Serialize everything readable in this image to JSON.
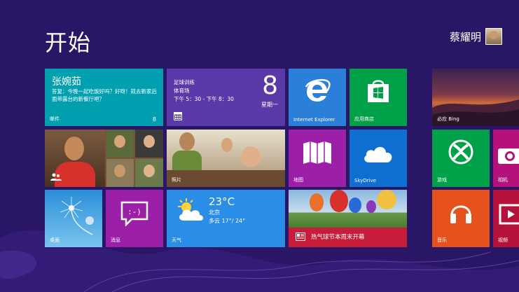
{
  "page": {
    "title": "开始"
  },
  "user": {
    "name": "蔡耀明"
  },
  "tiles": {
    "mail": {
      "sender": "张婉茹",
      "message": "答复：今晚一起吃饭好吗？好呀！就去新家后面带露台的新餐厅吧？",
      "label": "邮件",
      "count": "8",
      "color": "#00a0b1"
    },
    "calendar": {
      "event": "足球训练",
      "place": "体育场",
      "time": "下午 5：30 - 下午 8：30",
      "day_number": "8",
      "weekday": "星期一",
      "color": "#5a3aa8"
    },
    "ie": {
      "label": "Internet Explorer",
      "color": "#2a7fd8"
    },
    "store": {
      "label": "应用商店",
      "color": "#00a048"
    },
    "bing": {
      "label": "必应 Bing"
    },
    "people": {
      "label": ""
    },
    "photos": {
      "label": "照片"
    },
    "maps": {
      "label": "地图",
      "color": "#9c1fa8"
    },
    "skydrive": {
      "label": "SkyDrive",
      "color": "#0f6fd0"
    },
    "games": {
      "label": "游戏",
      "color": "#00a048"
    },
    "camera": {
      "label": "相机",
      "color": "#b4127a"
    },
    "desktop": {
      "label": "桌面"
    },
    "messaging": {
      "label": "消息",
      "color": "#9c1fa8"
    },
    "weather": {
      "temp": "23°C",
      "city": "北京",
      "condition": "多云 17°/ 24°",
      "label": "天气",
      "color": "#2a8ee6"
    },
    "news": {
      "headline": "热气球节本周末开幕",
      "color": "#c81d3a"
    },
    "music": {
      "label": "音乐",
      "color": "#e5521d"
    },
    "video": {
      "label": "视频",
      "color": "#b4123a"
    }
  }
}
